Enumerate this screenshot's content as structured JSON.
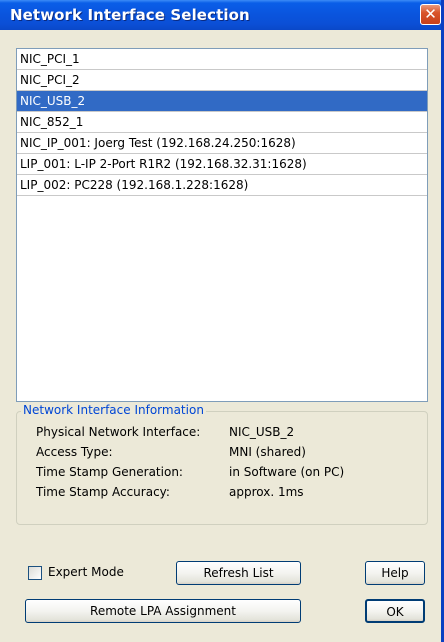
{
  "window": {
    "title": "Network Interface Selection",
    "close_glyph": "✕"
  },
  "interfaces": [
    "NIC_PCI_1",
    "NIC_PCI_2",
    "NIC_USB_2",
    "NIC_852_1",
    "NIC_IP_001: Joerg Test (192.168.24.250:1628)",
    "LIP_001: L-IP 2-Port R1R2 (192.168.32.31:1628)",
    "LIP_002: PC228 (192.168.1.228:1628)"
  ],
  "selected_index": 2,
  "info": {
    "group_title": "Network Interface Information",
    "rows": [
      {
        "label": "Physical Network Interface:",
        "value": "NIC_USB_2"
      },
      {
        "label": "Access Type:",
        "value": "MNI (shared)"
      },
      {
        "label": "Time Stamp Generation:",
        "value": "in Software (on PC)"
      },
      {
        "label": "Time Stamp Accuracy:",
        "value": "approx. 1ms"
      }
    ]
  },
  "controls": {
    "expert_mode_label": "Expert Mode",
    "expert_mode_checked": false,
    "refresh_label": "Refresh List",
    "help_label": "Help",
    "remote_lpa_label": "Remote LPA Assignment",
    "ok_label": "OK"
  },
  "colors": {
    "selection": "#316ac5",
    "titlebar": "#0a55de",
    "group_title": "#0046d5"
  }
}
